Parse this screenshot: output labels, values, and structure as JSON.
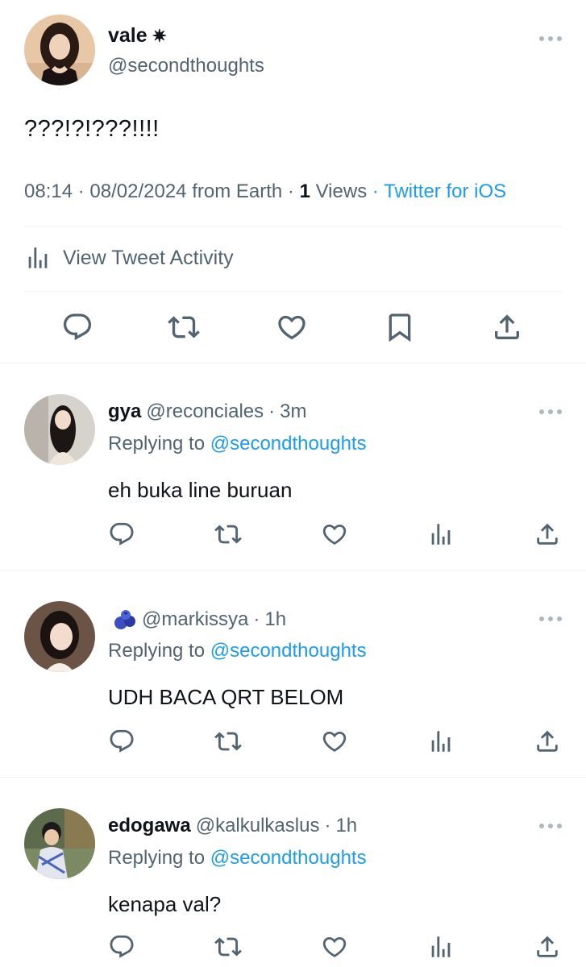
{
  "main_tweet": {
    "display_name": "vale",
    "name_badge": "✷",
    "handle": "@secondthoughts",
    "text": "???!?!???!!!!",
    "time": "08:14",
    "date": "08/02/2024",
    "location": "from Earth",
    "views_count": "1",
    "views_label": "Views",
    "client": "Twitter for iOS",
    "activity_label": "View Tweet Activity"
  },
  "replies": [
    {
      "display_name": "gya",
      "handle": "@reconciales",
      "time": "3m",
      "replying_prefix": "Replying to",
      "replying_handle": "@secondthoughts",
      "text": "eh buka line buruan"
    },
    {
      "display_name": "",
      "handle": "@markissya",
      "time": "1h",
      "replying_prefix": "Replying to",
      "replying_handle": "@secondthoughts",
      "text": "UDH BACA QRT BELOM"
    },
    {
      "display_name": "edogawa",
      "handle": "@kalkulkaslus",
      "time": "1h",
      "replying_prefix": "Replying to",
      "replying_handle": "@secondthoughts",
      "text": "kenapa val?"
    }
  ],
  "separator": "·",
  "colors": {
    "text": "#0f1419",
    "secondary": "#536471",
    "link": "#1d9bf0",
    "divider": "#eff3f4"
  },
  "icons": [
    "reply-icon",
    "retweet-icon",
    "like-icon",
    "bookmark-icon",
    "share-icon",
    "analytics-icon",
    "more-icon",
    "blueberry-emoji-icon"
  ]
}
